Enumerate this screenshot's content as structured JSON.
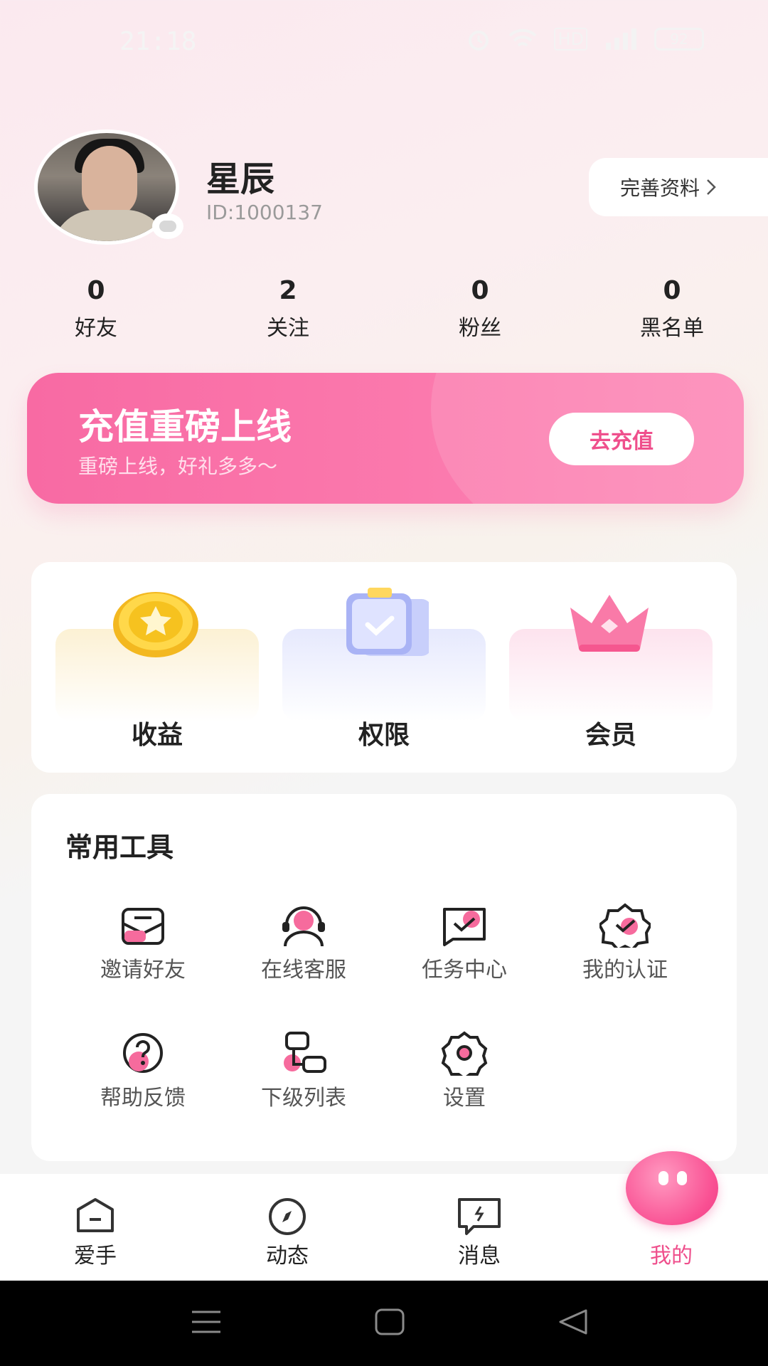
{
  "status": {
    "time": "21:18",
    "network": "HD",
    "battery": "92"
  },
  "profile": {
    "name": "星辰",
    "id": "ID:1000137",
    "edit_label": "完善资料",
    "stats": [
      {
        "value": "0",
        "label": "好友"
      },
      {
        "value": "2",
        "label": "关注"
      },
      {
        "value": "0",
        "label": "粉丝"
      },
      {
        "value": "0",
        "label": "黑名单"
      }
    ]
  },
  "banner": {
    "title": "充值重磅上线",
    "subtitle": "重磅上线，好礼多多～",
    "button": "去充值"
  },
  "features": [
    {
      "label": "收益",
      "icon": "gold-coin-icon"
    },
    {
      "label": "权限",
      "icon": "clipboard-check-icon"
    },
    {
      "label": "会员",
      "icon": "crown-icon"
    }
  ],
  "tools": {
    "heading": "常用工具",
    "items": [
      {
        "label": "邀请好友",
        "icon": "invite-envelope-icon"
      },
      {
        "label": "在线客服",
        "icon": "headset-icon"
      },
      {
        "label": "任务中心",
        "icon": "task-icon"
      },
      {
        "label": "我的认证",
        "icon": "verified-badge-icon"
      },
      {
        "label": "帮助反馈",
        "icon": "help-icon"
      },
      {
        "label": "下级列表",
        "icon": "subordinate-list-icon"
      },
      {
        "label": "设置",
        "icon": "gear-icon"
      }
    ]
  },
  "nav": {
    "items": [
      {
        "label": "爱手",
        "icon": "home-icon"
      },
      {
        "label": "动态",
        "icon": "compass-icon"
      },
      {
        "label": "消息",
        "icon": "message-icon"
      },
      {
        "label": "我的",
        "icon": "me-blob-icon",
        "active": true
      }
    ]
  },
  "colors": {
    "accent": "#ef4f8c",
    "banner": "#f86aa3"
  }
}
